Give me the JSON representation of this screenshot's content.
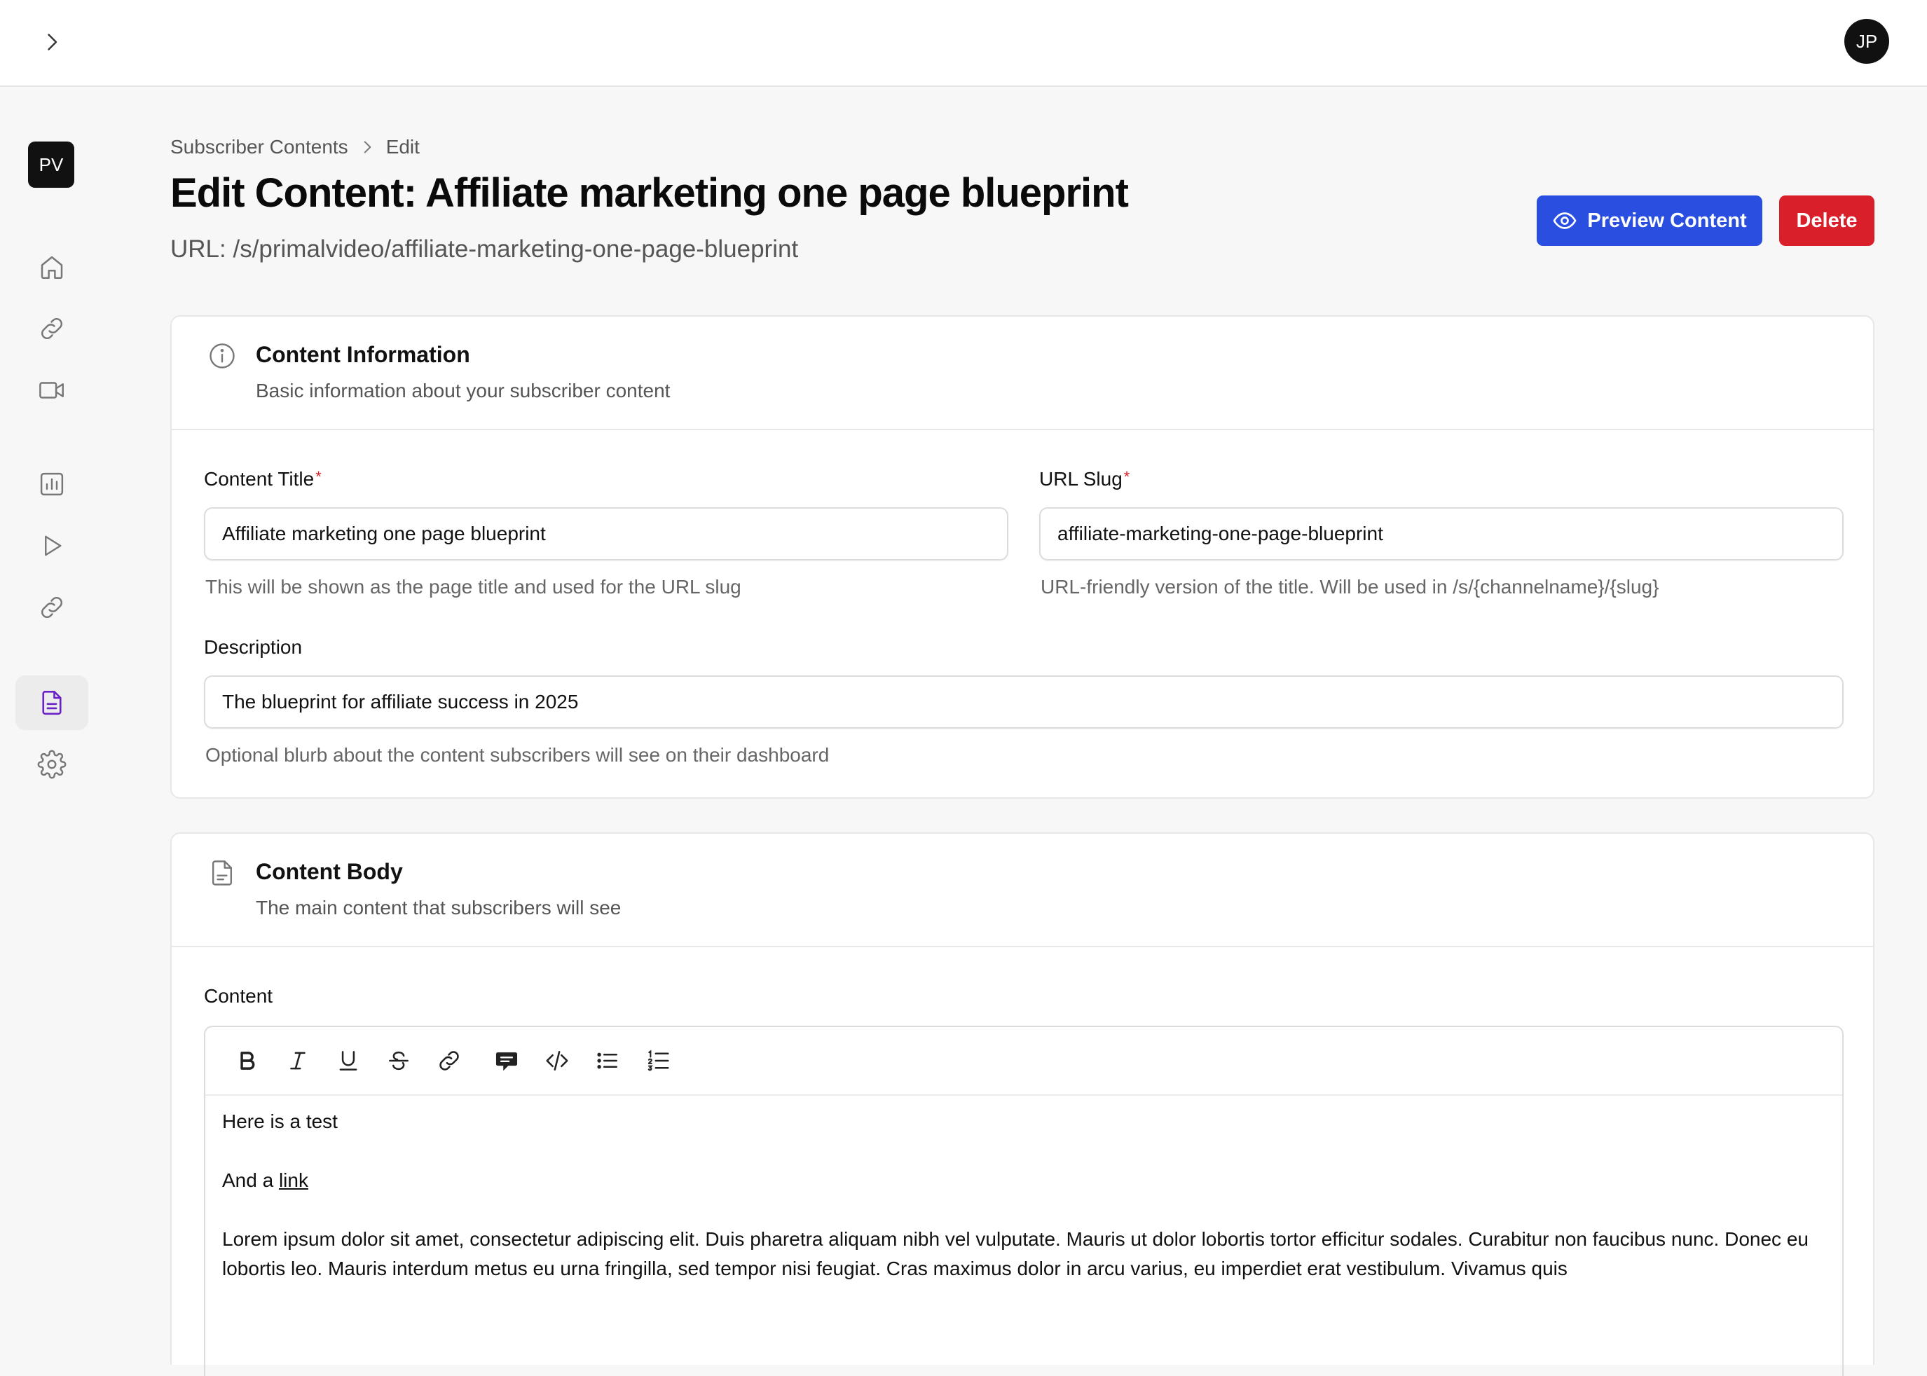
{
  "topbar": {
    "expand_icon": "chevron-right-icon",
    "user_initials": "JP"
  },
  "sidebar": {
    "brand_initials": "PV",
    "items": [
      {
        "icon": "home-icon",
        "active": false
      },
      {
        "icon": "link-icon",
        "active": false
      },
      {
        "icon": "video-icon",
        "active": false
      },
      {
        "icon": "bar-chart-icon",
        "active": false
      },
      {
        "icon": "play-icon",
        "active": false
      },
      {
        "icon": "link-icon",
        "active": false
      },
      {
        "icon": "document-icon",
        "active": true
      },
      {
        "icon": "gear-icon",
        "active": false
      }
    ],
    "active_color": "#6b21c8"
  },
  "header": {
    "breadcrumb": [
      "Subscriber Contents",
      "Edit"
    ],
    "title": "Edit Content: Affiliate marketing one page blueprint",
    "url": "URL: /s/primalvideo/affiliate-marketing-one-page-blueprint",
    "preview_label": "Preview Content",
    "delete_label": "Delete",
    "preview_color": "#2a4fe0",
    "delete_color": "#d81f2a"
  },
  "content_info": {
    "title": "Content Information",
    "subtitle": "Basic information about your subscriber content",
    "fields": {
      "content_title": {
        "label": "Content Title",
        "required_mark": "*",
        "value": "Affiliate marketing one page blueprint",
        "help": "This will be shown as the page title and used for the URL slug"
      },
      "url_slug": {
        "label": "URL Slug",
        "required_mark": "*",
        "value": "affiliate-marketing-one-page-blueprint",
        "help": "URL-friendly version of the title. Will be used in /s/{channelname}/{slug}"
      },
      "description": {
        "label": "Description",
        "value": "The blueprint for affiliate success in 2025",
        "help": "Optional blurb about the content subscribers will see on their dashboard"
      }
    }
  },
  "content_body": {
    "title": "Content Body",
    "subtitle": "The main content that subscribers will see",
    "field_label": "Content",
    "toolbar": [
      "bold-icon",
      "italic-icon",
      "underline-icon",
      "strikethrough-icon",
      "link-icon",
      "comment-icon",
      "code-icon",
      "bullet-list-icon",
      "numbered-list-icon"
    ],
    "paragraphs": {
      "p1": "Here is a test",
      "p2_prefix": "And a ",
      "p2_link": "link",
      "p3": "Lorem ipsum dolor sit amet, consectetur adipiscing elit. Duis pharetra aliquam nibh vel vulputate. Mauris ut dolor lobortis tortor efficitur sodales. Curabitur non faucibus nunc. Donec eu lobortis leo. Mauris interdum metus eu urna fringilla, sed tempor nisi feugiat. Cras maximus dolor in arcu varius, eu imperdiet erat vestibulum. Vivamus quis"
    }
  }
}
